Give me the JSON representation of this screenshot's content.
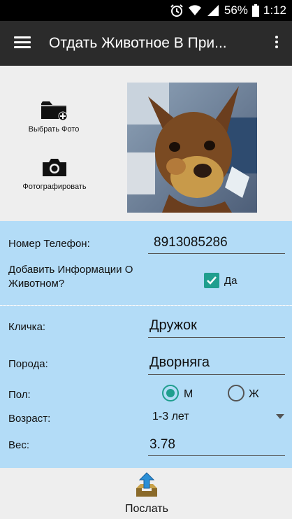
{
  "status_bar": {
    "battery": "56%",
    "time": "1:12"
  },
  "app_bar": {
    "title": "Отдать Животное В При..."
  },
  "photo": {
    "pick_label": "Выбрать Фото",
    "take_label": "Фотографировать"
  },
  "form": {
    "phone_label": "Номер Телефон:",
    "phone_value": "8913085286",
    "add_info_label": "Добавить Информации О Животном?",
    "add_info_checked": true,
    "yes_label": "Да",
    "name_label": "Кличка:",
    "name_value": "Дружок",
    "breed_label": "Порода:",
    "breed_value": "Дворняга",
    "sex_label": "Пол:",
    "sex_male": "М",
    "sex_female": "Ж",
    "sex_selected": "М",
    "age_label": "Возраст:",
    "age_value": "1-3 лет",
    "weight_label": "Вес:",
    "weight_value": "3.78"
  },
  "send": {
    "label": "Послать"
  },
  "colors": {
    "form_bg": "#b3dcf7",
    "accent": "#1f9e8e",
    "app_bar": "#2b2b2b"
  }
}
